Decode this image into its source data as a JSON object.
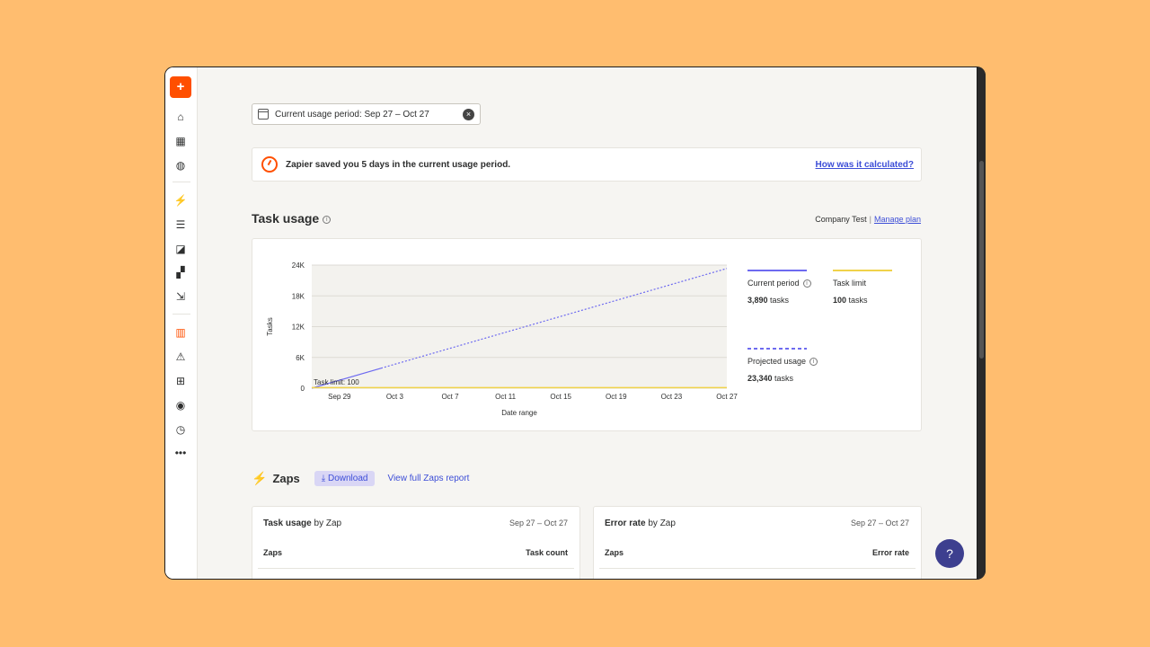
{
  "sidebar": {
    "create_label": "+",
    "icons": [
      "home-icon",
      "dashboard-icon",
      "globe-icon",
      "zap-icon",
      "interfaces-icon",
      "tables-icon",
      "canvas-icon",
      "transfer-icon",
      "usage-icon",
      "alert-icon",
      "apps-icon",
      "eye-icon",
      "history-icon",
      "more-icon"
    ]
  },
  "period_chip": {
    "label": "Current usage period: Sep 27 – Oct 27",
    "close": "×"
  },
  "banner": {
    "text": "Zapier saved you 5 days in the current usage period.",
    "link": "How was it calculated?"
  },
  "task_usage": {
    "title": "Task usage",
    "account": "Company Test",
    "separator": "|",
    "manage_plan": "Manage plan"
  },
  "chart_data": {
    "type": "line",
    "ylabel": "Tasks",
    "xlabel": "Date range",
    "ylim": [
      0,
      24000
    ],
    "yticks": [
      "0",
      "6K",
      "12K",
      "18K",
      "24K"
    ],
    "yticks_values": [
      0,
      6000,
      12000,
      18000,
      24000
    ],
    "xticks": [
      "Sep 29",
      "Oct 3",
      "Oct 7",
      "Oct 11",
      "Oct 15",
      "Oct 19",
      "Oct 23",
      "Oct 27"
    ],
    "x_range": [
      "Sep 27",
      "Oct 27"
    ],
    "grid": true,
    "annotation": "Task limit: 100",
    "series": [
      {
        "name": "Current period",
        "color": "#6d6af0",
        "style": "solid",
        "x": [
          "Sep 27",
          "Oct 2"
        ],
        "y": [
          0,
          3890
        ]
      },
      {
        "name": "Projected usage",
        "color": "#6d6af0",
        "style": "dashed",
        "x": [
          "Oct 2",
          "Oct 27"
        ],
        "y": [
          3890,
          23340
        ]
      },
      {
        "name": "Task limit",
        "color": "#f0d24a",
        "style": "solid",
        "x": [
          "Sep 27",
          "Oct 27"
        ],
        "y": [
          100,
          100
        ]
      }
    ]
  },
  "legend": {
    "current": {
      "name": "Current period",
      "value": "3,890",
      "unit": "tasks",
      "color": "#6d6af0"
    },
    "limit": {
      "name": "Task limit",
      "value": "100",
      "unit": "tasks",
      "color": "#f0d24a"
    },
    "projected": {
      "name": "Projected usage",
      "value": "23,340",
      "unit": "tasks",
      "color": "#6d6af0"
    }
  },
  "zaps": {
    "title": "Zaps",
    "download": "Download",
    "full_report": "View full Zaps report",
    "task_table": {
      "title_bold": "Task usage",
      "title_rest": " by Zap",
      "range": "Sep 27 – Oct 27",
      "col_left": "Zaps",
      "col_right": "Task count"
    },
    "error_table": {
      "title_bold": "Error rate",
      "title_rest": " by Zap",
      "range": "Sep 27 – Oct 27",
      "col_left": "Zaps",
      "col_right": "Error rate"
    }
  }
}
